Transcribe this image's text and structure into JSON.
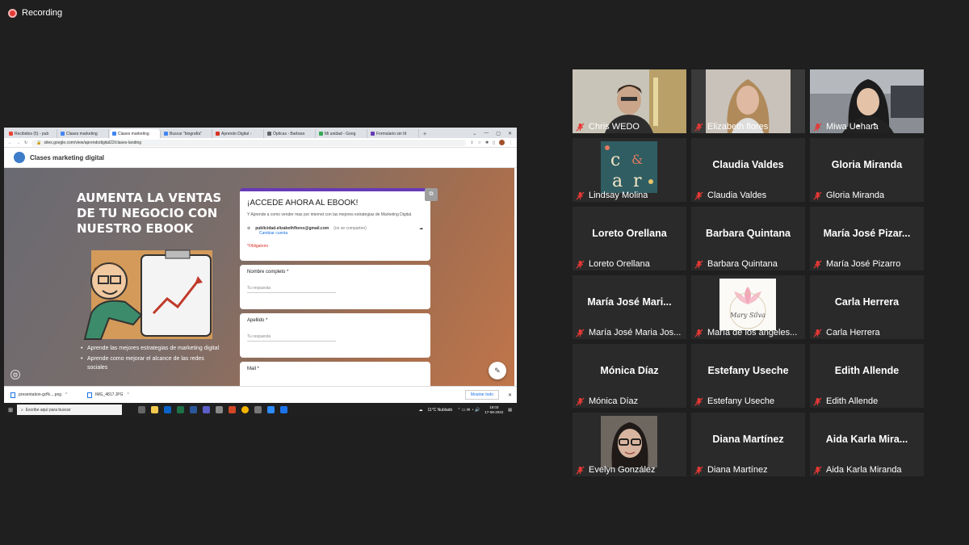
{
  "recording": {
    "label": "Recording"
  },
  "browser": {
    "tabs": [
      {
        "label": "Recibidos (5) - pub"
      },
      {
        "label": "Clases marketing"
      },
      {
        "label": "Clases marketing"
      },
      {
        "label": "Buscar \"biografía\""
      },
      {
        "label": "Aprendo Digital -"
      },
      {
        "label": "Ópticas - Barbara"
      },
      {
        "label": "Mi unidad - Goog"
      },
      {
        "label": "Formulario sin tít"
      }
    ],
    "url": "sites.google.com/view/aprendodigital22/clases-landing"
  },
  "site": {
    "title": "Clases marketing digital",
    "hero_title": "AUMENTA LA VENTAS DE TU NEGOCIO CON NUESTRO EBOOK",
    "bullets": [
      "Aprende las mejores estrategias de marketing digital",
      "Aprende como mejorar el alcance de las redes sociales"
    ]
  },
  "form": {
    "title": "¡ACCEDE AHORA AL EBOOK!",
    "description": "Y Aprende a como vender mas por internet con las mejores estrategias de Marketing Digital.",
    "email": "publicidad.elizabethflores@gmail.com",
    "email_note": "(no se comparten)",
    "change_account": "Cambiar cuenta",
    "required": "*Obligatorio",
    "questions": [
      {
        "label": "Nombre completo *",
        "placeholder": "Tu respuesta"
      },
      {
        "label": "Apellido *",
        "placeholder": "Tu respuesta"
      },
      {
        "label": "Mail *",
        "placeholder": ""
      }
    ]
  },
  "downloads": {
    "items": [
      {
        "name": "presentation-gd%....png"
      },
      {
        "name": "IMG_4817.JPG"
      }
    ],
    "show_all": "Mostrar todo"
  },
  "taskbar": {
    "search_placeholder": "Escribe aquí para buscar",
    "weather": "11°C  Nublado",
    "time": "18:03",
    "date": "17-08-2022"
  },
  "participants": [
    {
      "name": "Chris WEDO",
      "big": "",
      "video": "person-dark-hair",
      "active": false
    },
    {
      "name": "Elizabeth flores",
      "big": "",
      "video": "person-blonde",
      "active": true
    },
    {
      "name": "Miwa Uehara",
      "big": "",
      "video": "person-black-hair",
      "active": false
    },
    {
      "name": "Lindsay Molina",
      "big": "",
      "video": "logo-c-a-r",
      "active": false
    },
    {
      "name": "Claudia Valdes",
      "big": "Claudia Valdes",
      "video": "",
      "active": false
    },
    {
      "name": "Gloria Miranda",
      "big": "Gloria Miranda",
      "video": "",
      "active": false
    },
    {
      "name": "Loreto Orellana",
      "big": "Loreto Orellana",
      "video": "",
      "active": false
    },
    {
      "name": "Barbara Quintana",
      "big": "Barbara Quintana",
      "video": "",
      "active": false
    },
    {
      "name": "María José Pizarro",
      "big": "María José Pizar...",
      "video": "",
      "active": false
    },
    {
      "name": "María José Maria Jos...",
      "big": "María José Mari...",
      "video": "",
      "active": false
    },
    {
      "name": "María de los angeles...",
      "big": "",
      "video": "logo-lotus",
      "active": false
    },
    {
      "name": "Carla Herrera",
      "big": "Carla Herrera",
      "video": "",
      "active": false
    },
    {
      "name": "Mónica Díaz",
      "big": "Mónica Díaz",
      "video": "",
      "active": false
    },
    {
      "name": "Estefany Useche",
      "big": "Estefany Useche",
      "video": "",
      "active": false
    },
    {
      "name": "Edith Allende",
      "big": "Edith Allende",
      "video": "",
      "active": false
    },
    {
      "name": "Evelyn González",
      "big": "",
      "video": "person-glasses",
      "active": false
    },
    {
      "name": "Diana Martínez",
      "big": "Diana Martínez",
      "video": "",
      "active": false
    },
    {
      "name": "Aida Karla Miranda",
      "big": "Aida Karla Mira...",
      "video": "",
      "active": false
    }
  ],
  "colors": {
    "form_accent": "#673ab7",
    "active_speaker": "#c6e26a",
    "mic_off": "#e53935"
  }
}
